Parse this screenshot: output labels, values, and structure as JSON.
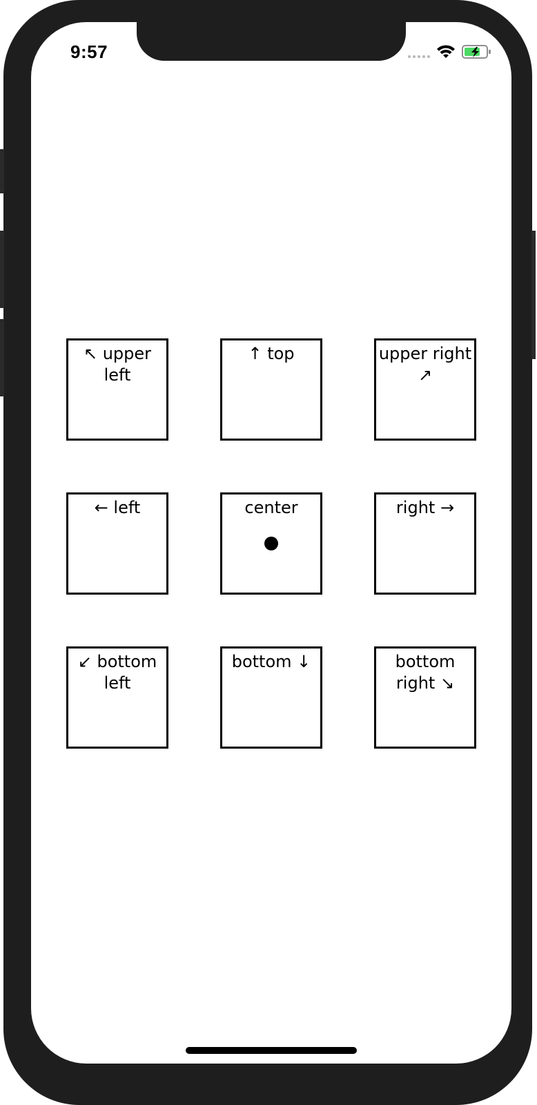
{
  "status_bar": {
    "time": "9:57"
  },
  "grid": {
    "cells": [
      {
        "label": "↖ upper\nleft"
      },
      {
        "label": "↑ top"
      },
      {
        "label": "upper right\n↗"
      },
      {
        "label": "← left"
      },
      {
        "label": "center"
      },
      {
        "label": "right →"
      },
      {
        "label": "↙ bottom\nleft"
      },
      {
        "label": "bottom ↓"
      },
      {
        "label": "bottom\nright ↘"
      }
    ]
  },
  "colors": {
    "battery_fill": "#4cd964",
    "frame": "#1e1e1e"
  }
}
